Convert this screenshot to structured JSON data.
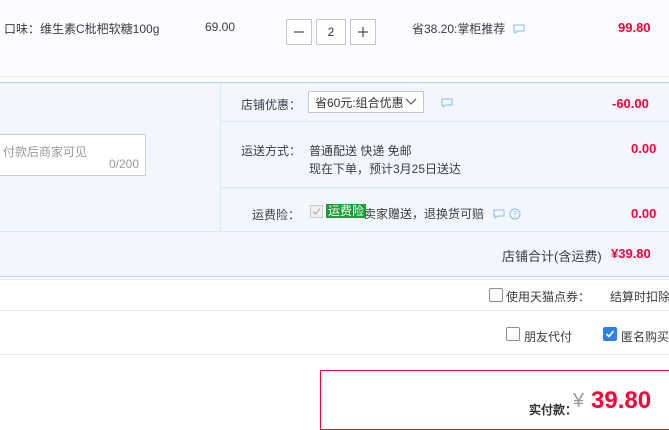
{
  "product": {
    "name": "口味：维生素C枇杷软糖100g",
    "unit_price": "69.00",
    "quantity": "2",
    "saving": "省38.20:掌柜推荐",
    "total": "99.80"
  },
  "promo": {
    "shop_discount_label": "店铺优惠：",
    "shop_discount_option": "省60元:组合优惠",
    "shop_discount_value": "-60.00",
    "message_placeholder": "付款后商家可见",
    "message_count": "0/200",
    "shipping_label": "运送方式：",
    "shipping_method": "普通配送 快递 免邮",
    "shipping_eta": "现在下单，预计3月25日送达",
    "shipping_value": "0.00",
    "insurance_label": "运费险：",
    "insurance_badge": "运费险",
    "insurance_text": "卖家赠送，退换货可赔",
    "insurance_value": "0.00",
    "shop_total_label": "店铺合计(含运费)",
    "shop_total_value": "¥39.80"
  },
  "options": {
    "tmall_points_label": "使用天猫点券：",
    "settle_deduct_label": "结算时扣除",
    "friend_pay_label": "朋友代付",
    "anonymous_label": "匿名购买"
  },
  "pay": {
    "label": "实付款：",
    "currency": "¥",
    "amount": "39.80"
  },
  "colors": {
    "accent_red": "#ff0036",
    "checkbox_blue": "#2f7ef0",
    "badge_green": "#1e9c35"
  },
  "icons": [
    "chat-icon",
    "help-icon",
    "chevron-down-icon",
    "check-icon",
    "minus-icon",
    "plus-icon"
  ]
}
